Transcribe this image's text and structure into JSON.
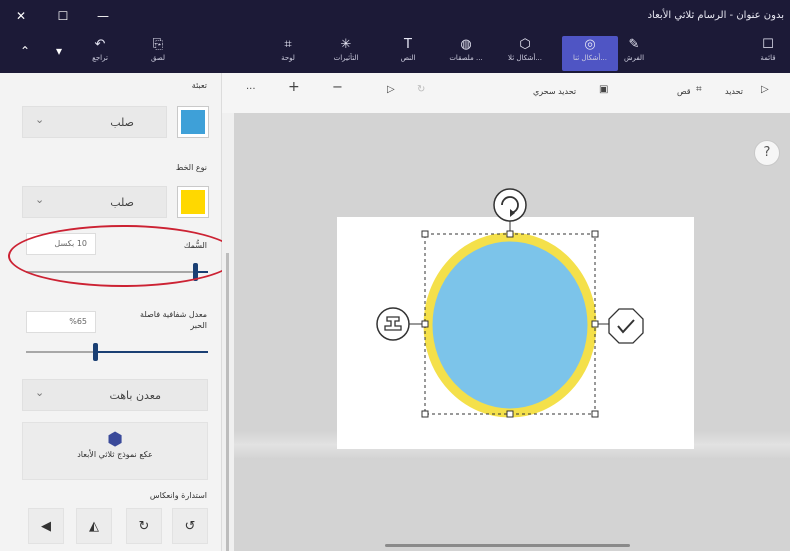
{
  "window": {
    "title": "بدون عنوان - الرسام ثلاثي الأبعاد",
    "controls": [
      "✕",
      "☐",
      "—"
    ]
  },
  "ribbon": {
    "items": [
      {
        "label": "قائمة",
        "icon": "menu-icon"
      },
      {
        "label": "الفرش",
        "icon": "brush-icon"
      },
      {
        "label": "أشكال ثنا...",
        "icon": "2d-shapes-icon"
      },
      {
        "label": "أشكال ثلا...",
        "icon": "3d-shapes-icon"
      },
      {
        "label": "ملصقات ...",
        "icon": "stickers-icon"
      },
      {
        "label": "النص",
        "icon": "text-icon"
      },
      {
        "label": "التأثيرات",
        "icon": "effects-icon"
      },
      {
        "label": "لوحة",
        "icon": "canvas-icon"
      },
      {
        "label": "لصق",
        "icon": "paste-icon"
      },
      {
        "label": "تراجع",
        "icon": "undo-icon"
      }
    ]
  },
  "toolbar": {
    "select_label": "تحديد",
    "crop_label": "قص",
    "magic_select_label": "تحديد سحري"
  },
  "panel": {
    "fill_label": "تعبئة",
    "fill_type": "صلب",
    "fill_color": "#3ea0d8",
    "line_type_label": "نوع الخط",
    "line_type": "صلب",
    "line_color": "#ffd800",
    "thickness_label": "السُّمك",
    "thickness_value": "10 بكسل",
    "thickness_level": 0.93,
    "opacity_label": "معدل شفافية فاصلة الحبر",
    "opacity_value": "%65",
    "opacity_level": 0.38,
    "material": "معدن باهت",
    "make3d_label": "عكع نموذج ثلاثي الأبعاد",
    "rotate_flip_label": "استدارة وانعكاس"
  },
  "canvas": {
    "help": "?",
    "shape_fill": "#7cc4ea",
    "shape_stroke": "#f4e04a"
  }
}
